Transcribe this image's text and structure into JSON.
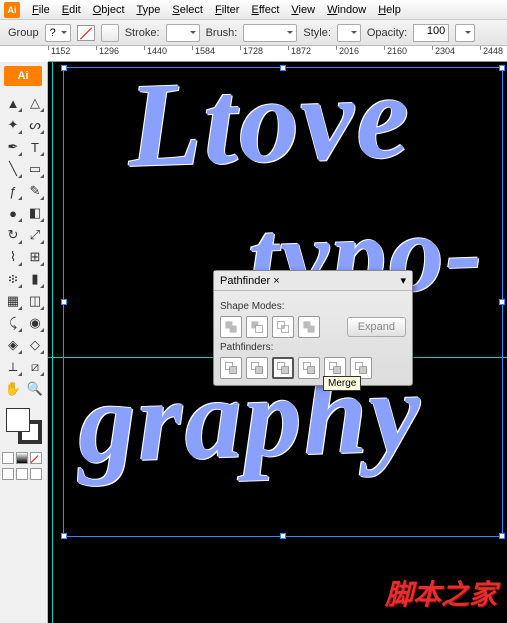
{
  "app": {
    "icon_text": "Ai",
    "badge": "Ai"
  },
  "menu": [
    "File",
    "Edit",
    "Object",
    "Type",
    "Select",
    "Filter",
    "Effect",
    "View",
    "Window",
    "Help"
  ],
  "controlbar": {
    "selection": "Group",
    "stroke_label": "Stroke:",
    "brush_label": "Brush:",
    "style_label": "Style:",
    "opacity_label": "Opacity:",
    "opacity_value": "100",
    "question": "?"
  },
  "ruler": {
    "ticks": [
      "1152",
      "1296",
      "1440",
      "1584",
      "1728",
      "1872",
      "2016",
      "2160",
      "2304",
      "2448"
    ]
  },
  "artwork": {
    "line1": "Ltove",
    "line2": "typo-",
    "line3": "graphy"
  },
  "panel": {
    "title": "Pathfinder",
    "close": "×",
    "menu": "▾",
    "shape_modes_label": "Shape Modes:",
    "pathfinders_label": "Pathfinders:",
    "expand_label": "Expand",
    "tooltip": "Merge"
  },
  "watermark": "脚本之家",
  "tools": [
    {
      "n": "selection",
      "g": "▲",
      "c": 1
    },
    {
      "n": "direct-select",
      "g": "△",
      "c": 1
    },
    {
      "n": "magic-wand",
      "g": "✦",
      "c": 1
    },
    {
      "n": "lasso",
      "g": "ᔕ",
      "c": 1
    },
    {
      "n": "pen",
      "g": "✒",
      "c": 1
    },
    {
      "n": "type",
      "g": "T",
      "c": 1
    },
    {
      "n": "line",
      "g": "╲",
      "c": 1
    },
    {
      "n": "rectangle",
      "g": "▭",
      "c": 1
    },
    {
      "n": "paintbrush",
      "g": "ƒ",
      "c": 1
    },
    {
      "n": "pencil",
      "g": "✎",
      "c": 1
    },
    {
      "n": "blob",
      "g": "●",
      "c": 1
    },
    {
      "n": "eraser",
      "g": "◧",
      "c": 1
    },
    {
      "n": "rotate",
      "g": "↻",
      "c": 1
    },
    {
      "n": "scale",
      "g": "⤢",
      "c": 1
    },
    {
      "n": "warp",
      "g": "⌇",
      "c": 1
    },
    {
      "n": "free-transform",
      "g": "⊞",
      "c": 1
    },
    {
      "n": "symbol-sprayer",
      "g": "፨",
      "c": 1
    },
    {
      "n": "graph",
      "g": "▮",
      "c": 1
    },
    {
      "n": "mesh",
      "g": "▦",
      "c": 1
    },
    {
      "n": "gradient",
      "g": "◫",
      "c": 1
    },
    {
      "n": "eyedropper",
      "g": "⤹",
      "c": 1
    },
    {
      "n": "blend",
      "g": "◉",
      "c": 1
    },
    {
      "n": "live-paint",
      "g": "◈",
      "c": 1
    },
    {
      "n": "live-paint-select",
      "g": "◇",
      "c": 1
    },
    {
      "n": "crop",
      "g": "⟂",
      "c": 1
    },
    {
      "n": "slice",
      "g": "⧄",
      "c": 1
    },
    {
      "n": "hand",
      "g": "✋",
      "c": 0
    },
    {
      "n": "zoom",
      "g": "🔍",
      "c": 0
    }
  ],
  "shape_modes": [
    {
      "n": "unite"
    },
    {
      "n": "minus-front"
    },
    {
      "n": "intersect"
    },
    {
      "n": "exclude"
    }
  ],
  "pathfinders": [
    {
      "n": "divide"
    },
    {
      "n": "trim"
    },
    {
      "n": "merge",
      "active": true
    },
    {
      "n": "crop"
    },
    {
      "n": "outline"
    },
    {
      "n": "minus-back"
    }
  ]
}
